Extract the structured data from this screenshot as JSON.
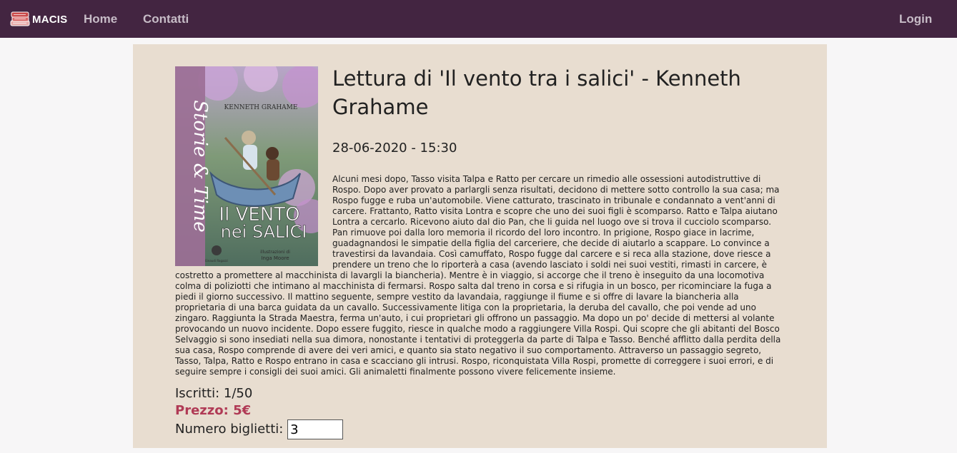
{
  "navbar": {
    "brand": "MACIS",
    "links": [
      "Home",
      "Contatti"
    ],
    "login": "Login",
    "colors": {
      "background": "#432541",
      "link": "#c7bcc7"
    }
  },
  "event": {
    "title": "Lettura di 'Il vento tra i salici' - Kenneth Grahame",
    "datetime": "28-06-2020 - 15:30",
    "cover": {
      "series": "Storie & Time",
      "author": "KENNETH GRAHAME",
      "title_line1": "Il VENTO",
      "title_line2": "nei SALICI",
      "publisher": "Einaudi Ragazzi",
      "illustrator_line1": "illustrazioni di",
      "illustrator_line2": "Inga Moore"
    },
    "description": "Alcuni mesi dopo, Tasso visita Talpa e Ratto per cercare un rimedio alle ossessioni autodistruttive di Rospo. Dopo aver provato a parlargli senza risultati, decidono di mettere sotto controllo la sua casa; ma Rospo fugge e ruba un'automobile. Viene catturato, trascinato in tribunale e condannato a vent'anni di carcere. Frattanto, Ratto visita Lontra e scopre che uno dei suoi figli è scomparso. Ratto e Talpa aiutano Lontra a cercarlo. Ricevono aiuto dal dio Pan, che li guida nel luogo ove si trova il cucciolo scomparso. Pan rimuove poi dalla loro memoria il ricordo del loro incontro. In prigione, Rospo giace in lacrime, guadagnandosi le simpatie della figlia del carceriere, che decide di aiutarlo a scappare. Lo convince a travestirsi da lavandaia. Così camuffato, Rospo fugge dal carcere e si reca alla stazione, dove riesce a prendere un treno che lo riporterà a casa (avendo lasciato i soldi nei suoi vestiti, rimasti in carcere, è costretto a promettere al macchinista di lavargli la biancheria). Mentre è in viaggio, si accorge che il treno è inseguito da una locomotiva colma di poliziotti che intimano al macchinista di fermarsi. Rospo salta dal treno in corsa e si rifugia in un bosco, per ricominciare la fuga a piedi il giorno successivo. Il mattino seguente, sempre vestito da lavandaia, raggiunge il fiume e si offre di lavare la biancheria alla proprietaria di una barca guidata da un cavallo. Successivamente litiga con la proprietaria, la deruba del cavallo, che poi vende ad uno zingaro. Raggiunta la Strada Maestra, ferma un'auto, i cui proprietari gli offrono un passaggio. Ma dopo un po' decide di mettersi al volante provocando un nuovo incidente. Dopo essere fuggito, riesce in qualche modo a raggiungere Villa Rospi. Qui scopre che gli abitanti del Bosco Selvaggio si sono insediati nella sua dimora, nonostante i tentativi di proteggerla da parte di Talpa e Tasso. Benché afflitto dalla perdita della sua casa, Rospo comprende di avere dei veri amici, e quanto sia stato negativo il suo comportamento. Attraverso un passaggio segreto, Tasso, Talpa, Ratto e Rospo entrano in casa e scacciano gli intrusi. Rospo, riconquistata Villa Rospi, promette di correggere i suoi errori, e di seguire sempre i consigli dei suoi amici. Gli animaletti finalmente possono vivere felicemente insieme.",
    "enrolled_label": "Iscritti:",
    "enrolled_value": "1/50",
    "price_label": "Prezzo:",
    "price_value": "5€",
    "tickets_label": "Numero biglietti:",
    "tickets_value": "3",
    "colors": {
      "card": "#e8ddd0",
      "price": "#b03a55"
    }
  }
}
